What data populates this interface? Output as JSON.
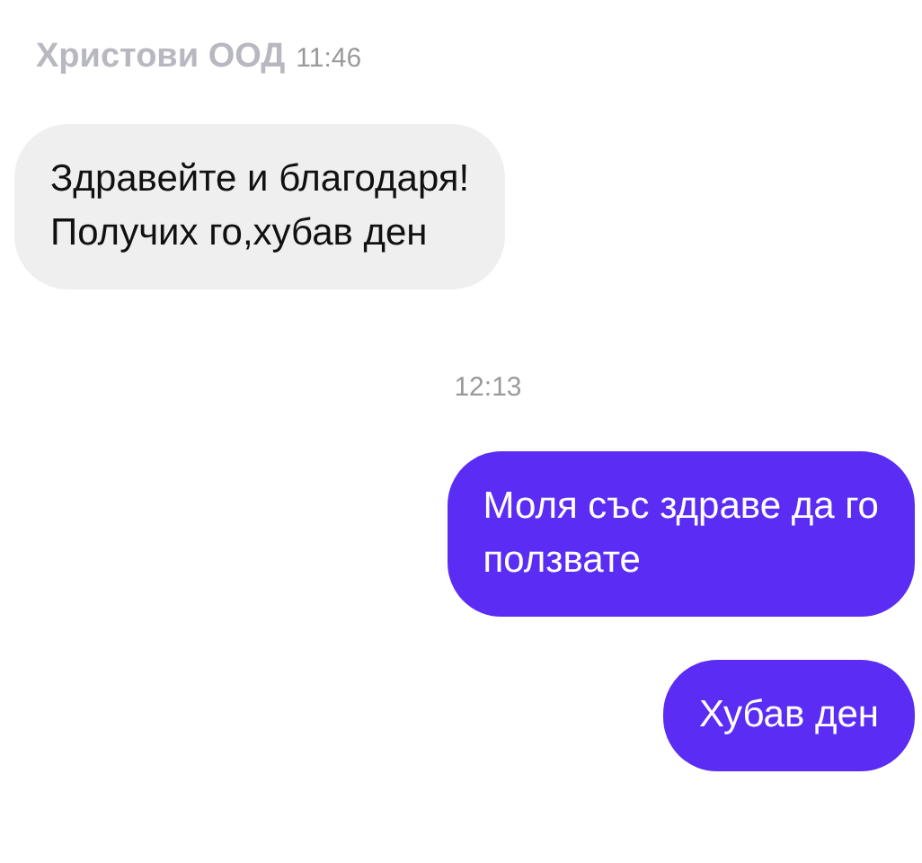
{
  "header": {
    "sender": "Христови ООД",
    "time": "11:46"
  },
  "messages": [
    {
      "kind": "incoming",
      "text": "Здравейте и благодаря!\nПолучих го,хубав ден"
    },
    {
      "kind": "time",
      "text": "12:13"
    },
    {
      "kind": "outgoing",
      "text": "Моля със здраве да го\nползвате"
    },
    {
      "kind": "outgoing",
      "text": "Хубав ден"
    }
  ]
}
